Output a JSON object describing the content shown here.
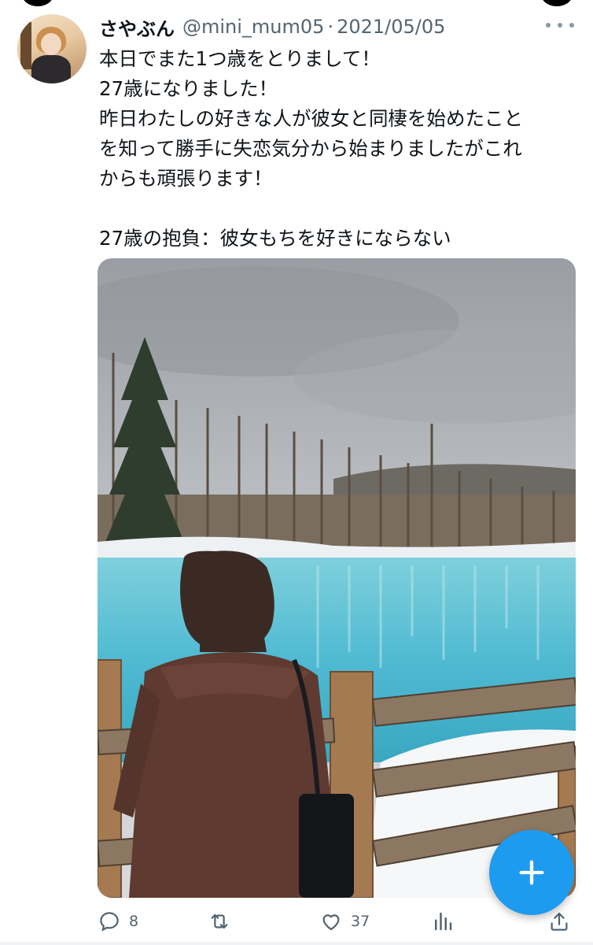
{
  "tweet": {
    "display_name": "さやぶん",
    "handle": "@mini_mum05",
    "separator": "·",
    "date": "2021/05/05",
    "text": "本日でまた1つ歳をとりまして！\n27歳になりました！\n昨日わたしの好きな人が彼女と同棲を始めたこと\nを知って勝手に失恋気分から始まりましたがこれ\nからも頑張ります！\n\n27歳の抱負：彼女もちを好きにならない"
  },
  "actions": {
    "reply": {
      "icon": "reply-icon",
      "count": "8"
    },
    "retweet": {
      "icon": "retweet-icon",
      "count": ""
    },
    "like": {
      "icon": "heart-icon",
      "count": "37"
    },
    "analytics": {
      "icon": "analytics-icon"
    },
    "share": {
      "icon": "share-icon"
    }
  },
  "compose_button": {
    "icon": "plus-icon"
  },
  "colors": {
    "accent": "#1d9bf0",
    "secondary_text": "#536471",
    "primary_text": "#0f1419",
    "pond": "#5cc4d8"
  }
}
